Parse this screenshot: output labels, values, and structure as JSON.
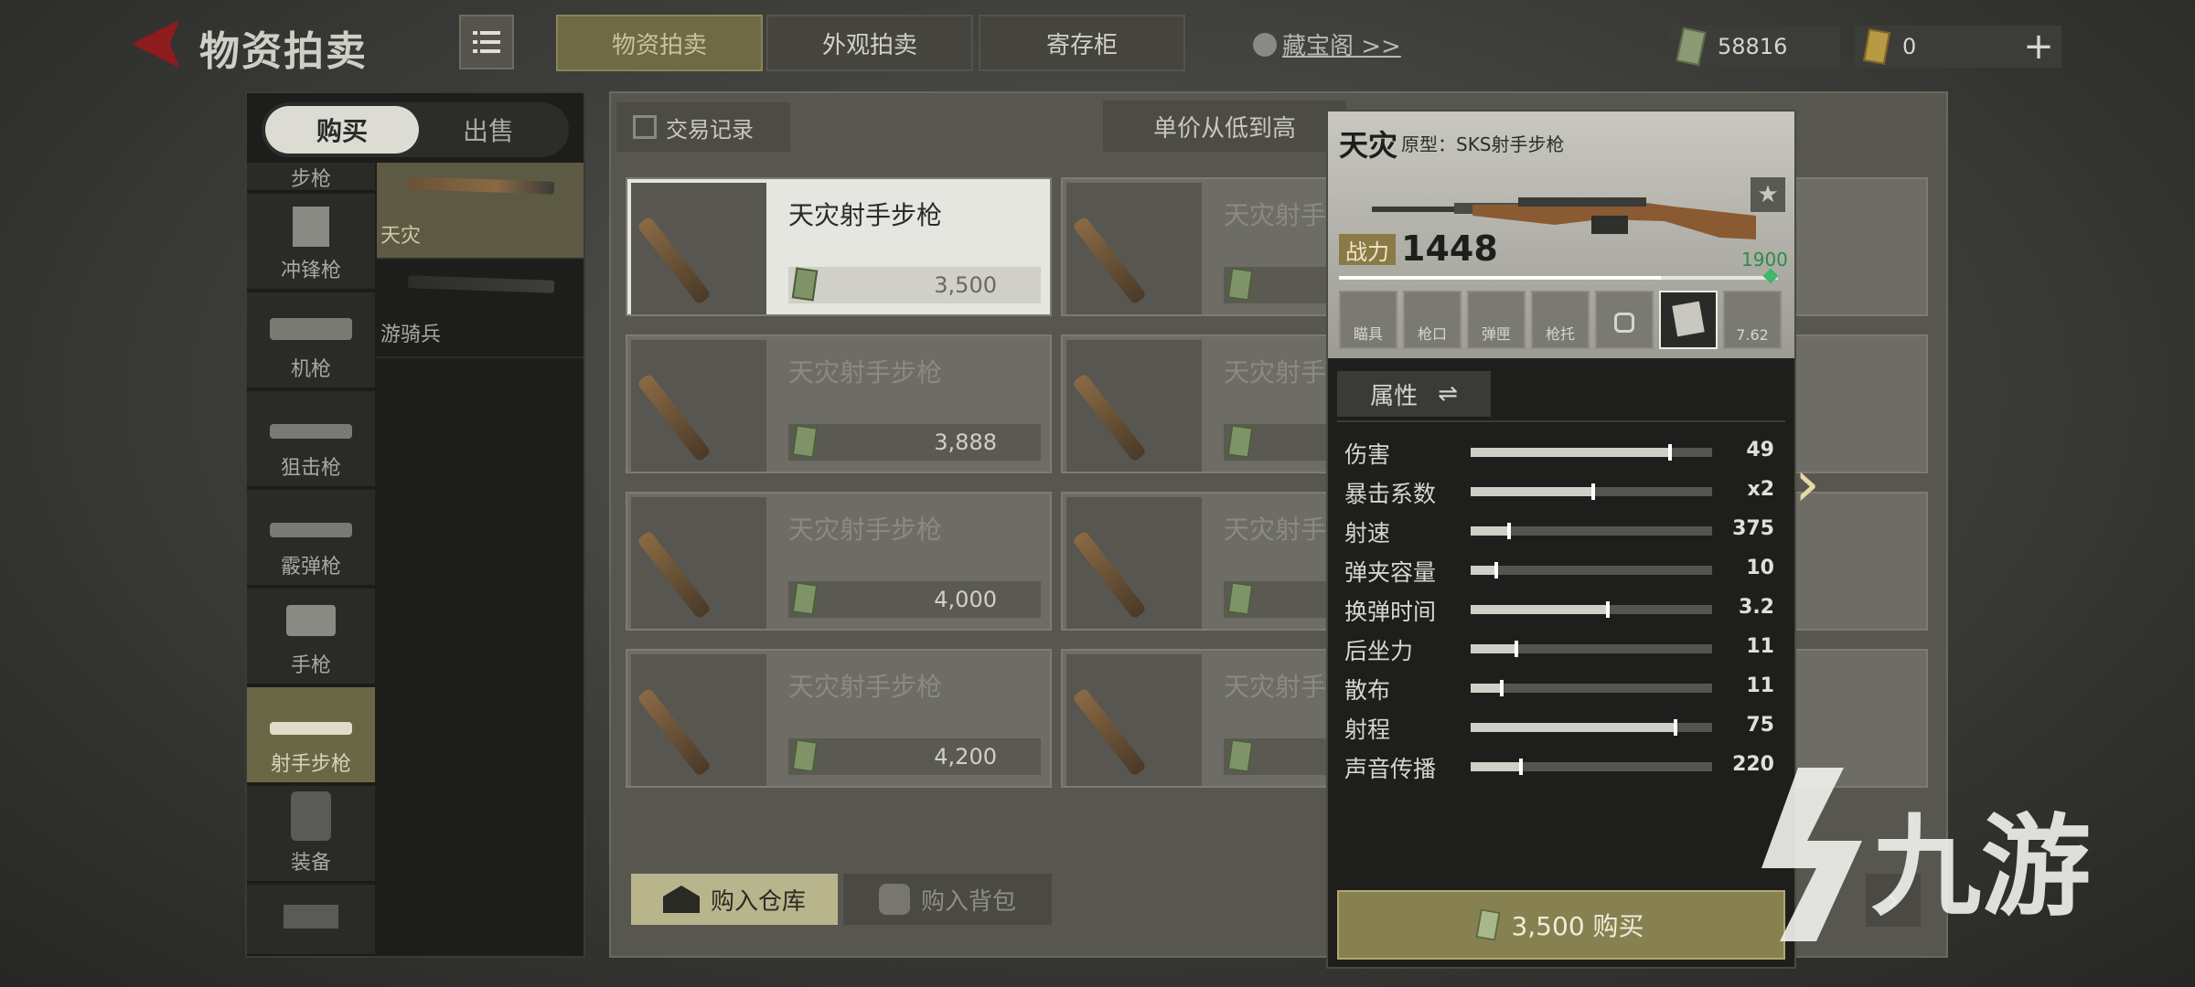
{
  "header": {
    "title": "物资拍卖",
    "tabs": [
      {
        "label": "物资拍卖",
        "active": true
      },
      {
        "label": "外观拍卖",
        "active": false
      },
      {
        "label": "寄存柜",
        "active": false
      }
    ],
    "treasure_link": "藏宝阁 >>",
    "currency_cash": "58816",
    "currency_gold": "0"
  },
  "left": {
    "toggle": {
      "buy": "购买",
      "sell": "出售"
    },
    "categories": [
      {
        "label": "步枪",
        "active": false
      },
      {
        "label": "冲锋枪",
        "active": false
      },
      {
        "label": "机枪",
        "active": false
      },
      {
        "label": "狙击枪",
        "active": false
      },
      {
        "label": "霰弹枪",
        "active": false
      },
      {
        "label": "手枪",
        "active": false
      },
      {
        "label": "射手步枪",
        "active": true
      },
      {
        "label": "装备",
        "active": false
      }
    ],
    "sub_items": [
      {
        "label": "天灾",
        "active": true
      },
      {
        "label": "游骑兵",
        "active": false
      }
    ]
  },
  "main": {
    "trade_record": "交易记录",
    "sort_label": "单价从低到高",
    "cards": [
      {
        "name": "天灾射手步枪",
        "price": "3,500",
        "active": true
      },
      {
        "name": "天灾射手步枪",
        "price": "3,888",
        "active": false
      },
      {
        "name": "天灾射手步枪",
        "price": "4,000",
        "active": false
      },
      {
        "name": "天灾射手步枪",
        "price": "4,200",
        "active": false
      }
    ],
    "card_col2_name": "天灾射手",
    "buy_warehouse": "购入仓库",
    "buy_backpack": "购入背包"
  },
  "detail": {
    "name": "天灾",
    "prototype": "原型：SKS射手步枪",
    "power_label": "战力",
    "power_value": "1448",
    "power_max": "1900",
    "power_progress": 0.76,
    "slots": [
      "瞄具",
      "枪口",
      "弹匣",
      "枪托",
      "",
      "",
      "7.62"
    ],
    "attr_tab": "属性",
    "stats": [
      {
        "name": "伤害",
        "value": "49",
        "level": 0.82
      },
      {
        "name": "暴击系数",
        "value": "x2",
        "level": 0.5
      },
      {
        "name": "射速",
        "value": "375",
        "level": 0.15
      },
      {
        "name": "弹夹容量",
        "value": "10",
        "level": 0.1
      },
      {
        "name": "换弹时间",
        "value": "3.2",
        "level": 0.56
      },
      {
        "name": "后坐力",
        "value": "11",
        "level": 0.18
      },
      {
        "name": "散布",
        "value": "11",
        "level": 0.12
      },
      {
        "name": "射程",
        "value": "75",
        "level": 0.84
      },
      {
        "name": "声音传播",
        "value": "220",
        "level": 0.2
      }
    ],
    "buy_button": "3,500 购买"
  },
  "watermark": "九游",
  "colors": {
    "accent": "#878050",
    "tab_active": "#6d6a44",
    "power_green": "#2f8a4a"
  }
}
